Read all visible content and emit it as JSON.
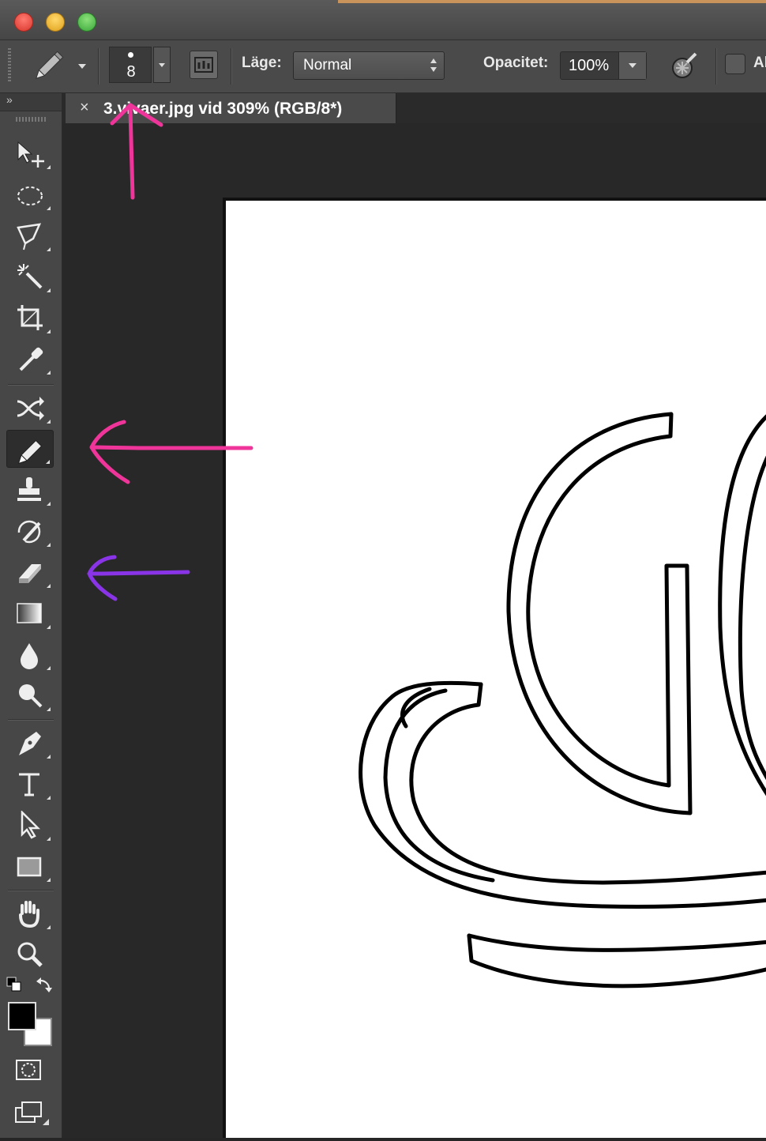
{
  "window": {
    "traffic_lights": [
      "close",
      "minimize",
      "zoom"
    ]
  },
  "options_bar": {
    "brush_size": "8",
    "mode_label": "Läge:",
    "mode_value": "Normal",
    "opacity_label": "Opacitet:",
    "opacity_value": "100%",
    "truncated_label": "Al"
  },
  "document_tab": {
    "close_glyph": "×",
    "title": "3.vivaer.jpg vid 309% (RGB/8*)"
  },
  "toolbar": {
    "collapse_glyph": "»",
    "tools": [
      "move",
      "elliptical-marquee",
      "polygonal-lasso",
      "magic-wand",
      "crop",
      "eyedropper",
      "content-aware-move",
      "pencil",
      "clone-stamp",
      "history-brush",
      "eraser",
      "gradient",
      "blur",
      "dodge",
      "pen",
      "type",
      "path-selection",
      "rectangle",
      "hand",
      "zoom"
    ],
    "active_tool": "pencil",
    "foreground_color": "#000000",
    "background_color": "#ffffff"
  },
  "annotations": {
    "arrow_up_color": "#f0359a",
    "arrow_pencil_color": "#f0359a",
    "arrow_eraser_color": "#8a34e8"
  }
}
